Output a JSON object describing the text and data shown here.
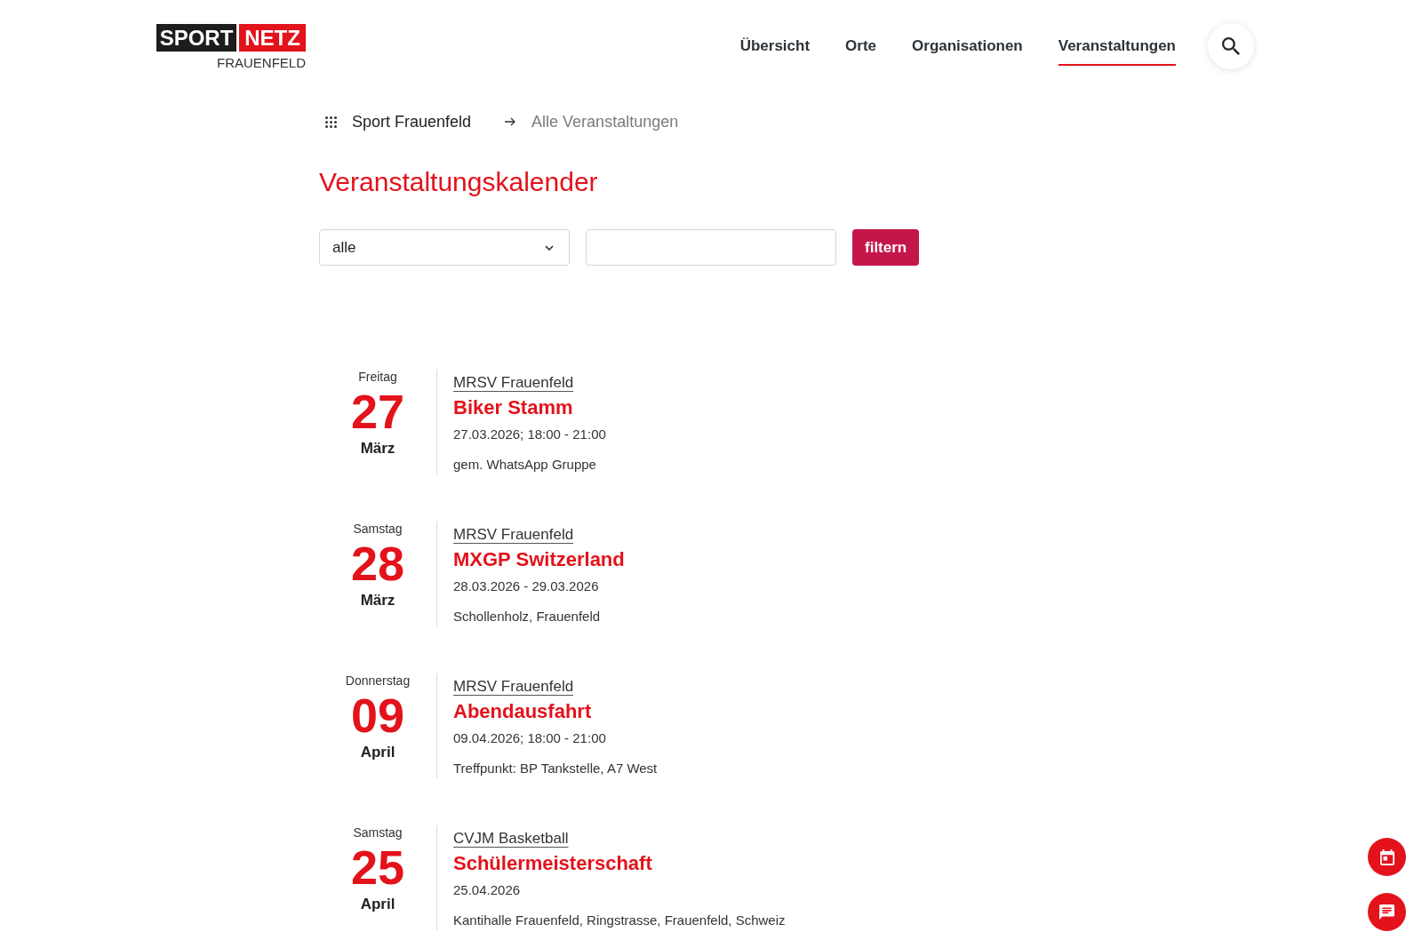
{
  "header": {
    "logo": {
      "word_1": "SPORT",
      "word_2": "NETZ",
      "subtitle": "FRAUENFELD"
    },
    "nav": [
      {
        "label": "Übersicht",
        "selected": false
      },
      {
        "label": "Orte",
        "selected": false
      },
      {
        "label": "Organisationen",
        "selected": false
      },
      {
        "label": "Veranstaltungen",
        "selected": true
      }
    ]
  },
  "breadcrumb": [
    {
      "label": "Sport Frauenfeld",
      "current": false
    },
    {
      "label": "Alle Veranstaltungen",
      "current": true
    }
  ],
  "title": "Veranstaltungskalender",
  "filters": {
    "category_select": {
      "value": "alle"
    },
    "filter_button": {
      "label": "filtern"
    }
  },
  "events": [
    {
      "weekday": "Freitag",
      "day": "27",
      "month": "März",
      "organizer": "MRSV Frauenfeld",
      "title": "Biker Stamm",
      "when": "27.03.2026; 18:00 - 21:00",
      "location": "gem. WhatsApp Gruppe"
    },
    {
      "weekday": "Samstag",
      "day": "28",
      "month": "März",
      "organizer": "MRSV Frauenfeld",
      "title": "MXGP Switzerland",
      "when": "28.03.2026 - 29.03.2026",
      "location": "Schollenholz, Frauenfeld"
    },
    {
      "weekday": "Donnerstag",
      "day": "09",
      "month": "April",
      "organizer": "MRSV Frauenfeld",
      "title": "Abendausfahrt",
      "when": "09.04.2026; 18:00 - 21:00",
      "location": "Treffpunkt: BP Tankstelle, A7 West"
    },
    {
      "weekday": "Samstag",
      "day": "25",
      "month": "April",
      "organizer": "CVJM Basketball",
      "title": "Schülermeisterschaft",
      "when": "25.04.2026",
      "location": "Kantihalle Frauenfeld, Ringstrasse, Frauenfeld, Schweiz"
    }
  ]
}
